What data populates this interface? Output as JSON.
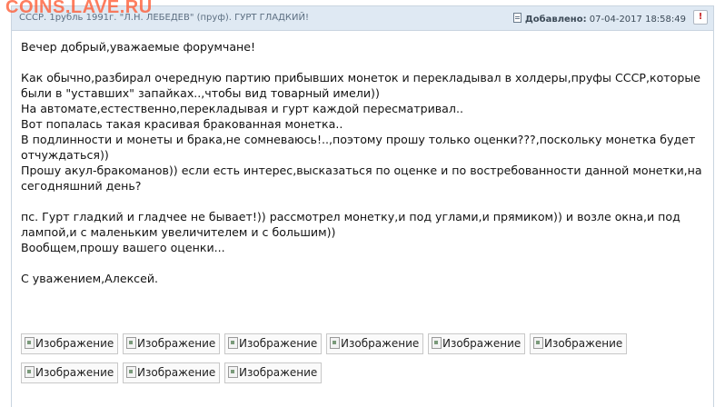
{
  "watermark": "COINS.LAVE.RU",
  "post": {
    "title": "СССР. 1рубль 1991г. \"Л.Н. ЛЕБЕДЕВ\" (пруф). ГУРТ ГЛАДКИЙ!",
    "added_label": "Добавлено:",
    "date": "07-04-2017 18:58:49",
    "report_icon": "!",
    "body": {
      "greeting": "Вечер добрый,уважаемые форумчане!",
      "p1": "Как обычно,разбирал очередную партию прибывших монеток и перекладывал в холдеры,пруфы СССР,которые были в \"уставших\" запайках..,чтобы вид товарный имели))",
      "p2": "На автомате,естественно,перекладывая и гурт каждой пересматривал..",
      "p3": "Вот попалась такая красивая бракованная монетка..",
      "p4": "В подлинности и монеты и брака,не сомневаюсь!..,поэтому прошу только оценки???,поскольку монетка будет отчуждаться))",
      "p5": "Прошу акул-бракоманов)) если есть интерес,высказаться по оценке и по востребованности данной монетки,на сегодняшний день?",
      "p6": "пс. Гурт гладкий и гладчее не бывает!)) рассмотрел монетку,и под углами,и прямиком)) и возле окна,и под лампой,и с маленьким увеличителем и с большим))",
      "p7": "Вообщем,прошу вашего оценки...",
      "signature": "С уважением,Алексей."
    },
    "images": [
      "Изображение",
      "Изображение",
      "Изображение",
      "Изображение",
      "Изображение",
      "Изображение",
      "Изображение",
      "Изображение",
      "Изображение"
    ]
  },
  "colors": {
    "header_bg": "#dfe9f3",
    "border": "#c9d4e0",
    "watermark": "#ff5a32",
    "report": "#c62828"
  },
  "icons": {
    "date": "document-icon",
    "report": "report-icon",
    "image": "broken-image-icon"
  }
}
